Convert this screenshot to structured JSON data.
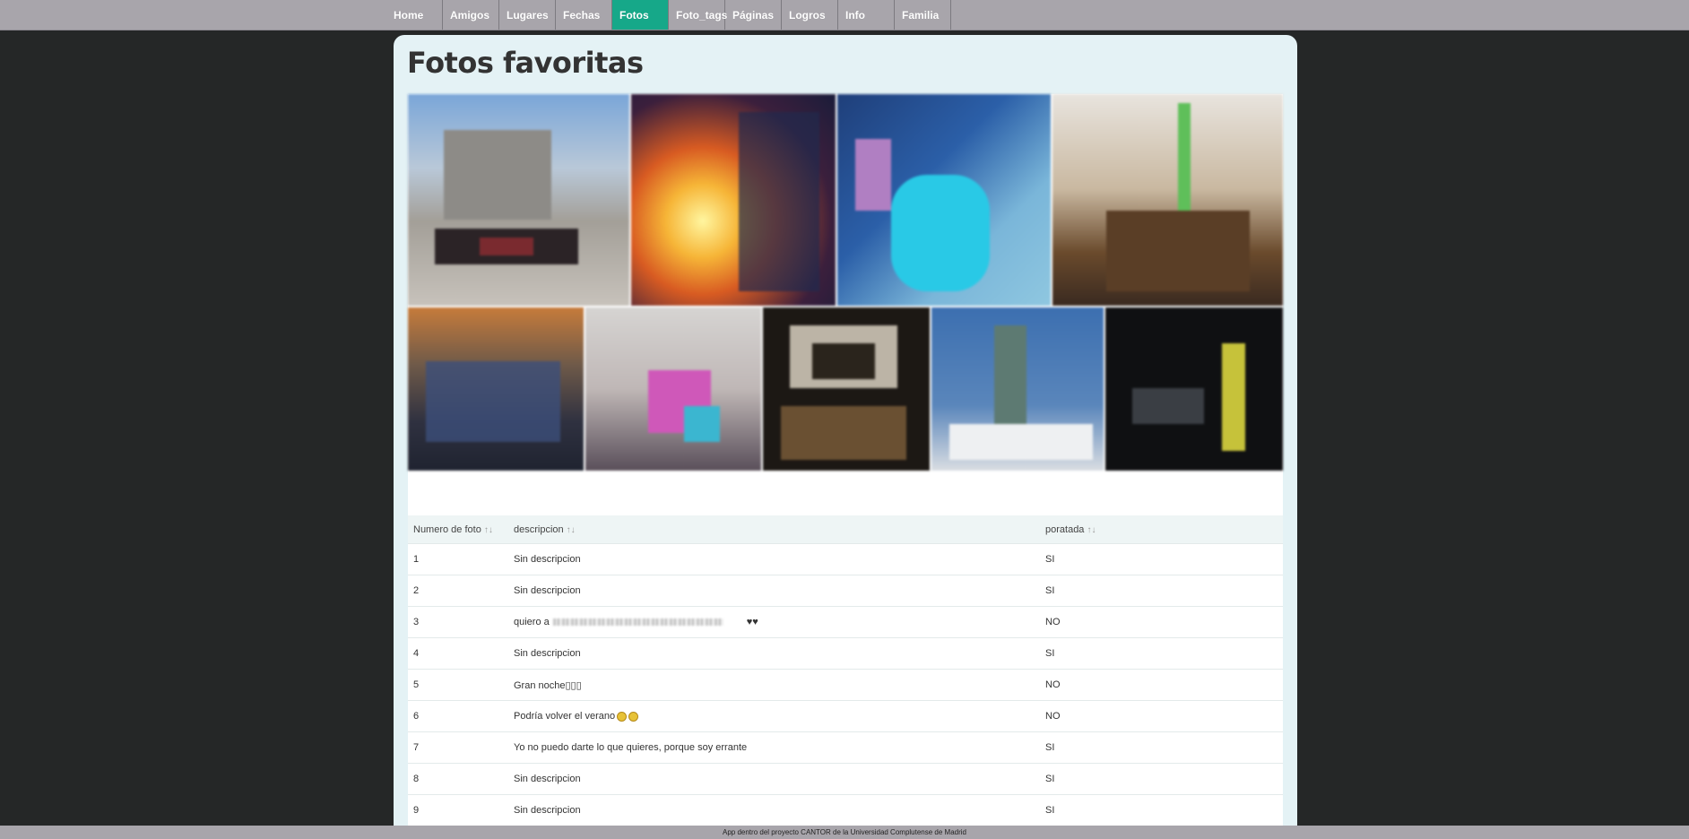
{
  "nav": {
    "items": [
      {
        "label": "Home",
        "active": false
      },
      {
        "label": "Amigos",
        "active": false
      },
      {
        "label": "Lugares",
        "active": false
      },
      {
        "label": "Fechas",
        "active": false
      },
      {
        "label": "Fotos",
        "active": true
      },
      {
        "label": "Foto_tags",
        "active": false
      },
      {
        "label": "Páginas",
        "active": false
      },
      {
        "label": "Logros",
        "active": false
      },
      {
        "label": "Info",
        "active": false
      },
      {
        "label": "Familia",
        "active": false
      }
    ]
  },
  "page": {
    "title": "Fotos favoritas"
  },
  "table": {
    "headers": {
      "numero": "Numero de foto",
      "descripcion": "descripcion",
      "portada": "poratada",
      "sort_glyph": "↑↓"
    },
    "rows": [
      {
        "numero": "1",
        "descripcion": "Sin descripcion",
        "portada": "SI"
      },
      {
        "numero": "2",
        "descripcion": "Sin descripcion",
        "portada": "SI"
      },
      {
        "numero": "3",
        "descripcion": "quiero a",
        "descripcion_suffix": "♥♥",
        "portada": "NO"
      },
      {
        "numero": "4",
        "descripcion": "Sin descripcion",
        "portada": "SI"
      },
      {
        "numero": "5",
        "descripcion": "Gran noche▯▯▯",
        "portada": "NO"
      },
      {
        "numero": "6",
        "descripcion": "Podría volver el verano",
        "portada": "NO"
      },
      {
        "numero": "7",
        "descripcion": "Yo no puedo darte lo que quieres, porque soy errante",
        "portada": "SI"
      },
      {
        "numero": "8",
        "descripcion": "Sin descripcion",
        "portada": "SI"
      },
      {
        "numero": "9",
        "descripcion": "Sin descripcion",
        "portada": "SI"
      }
    ]
  },
  "footer": {
    "text": "App dentro del proyecto CANTOR de la Universidad Complutense de Madrid"
  }
}
